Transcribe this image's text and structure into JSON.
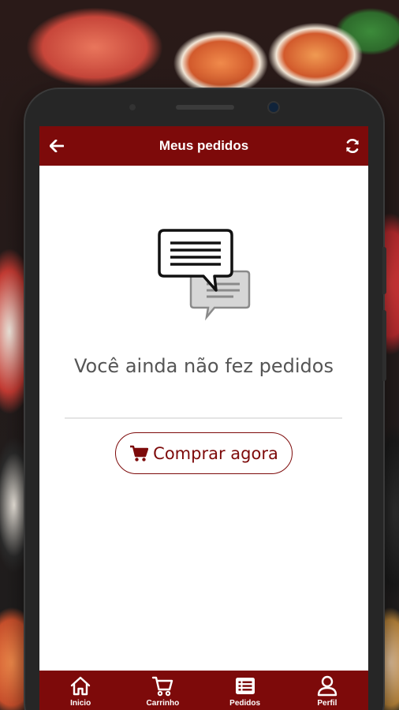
{
  "appbar": {
    "title": "Meus pedidos",
    "back_icon": "arrow-left-icon",
    "refresh_icon": "refresh-icon"
  },
  "empty_state": {
    "icon": "chat-bubbles-icon",
    "message": "Você ainda não fez pedidos"
  },
  "buy_button": {
    "label": "Comprar agora",
    "icon": "cart-icon"
  },
  "bottom_nav": {
    "items": [
      {
        "label": "Inicio",
        "icon": "home-icon"
      },
      {
        "label": "Carrinho",
        "icon": "cart-icon"
      },
      {
        "label": "Pedidos",
        "icon": "list-icon"
      },
      {
        "label": "Perfil",
        "icon": "user-icon"
      }
    ]
  },
  "colors": {
    "brand": "#7d0a0a",
    "text_muted": "#555555",
    "divider": "#e4e4e4"
  }
}
